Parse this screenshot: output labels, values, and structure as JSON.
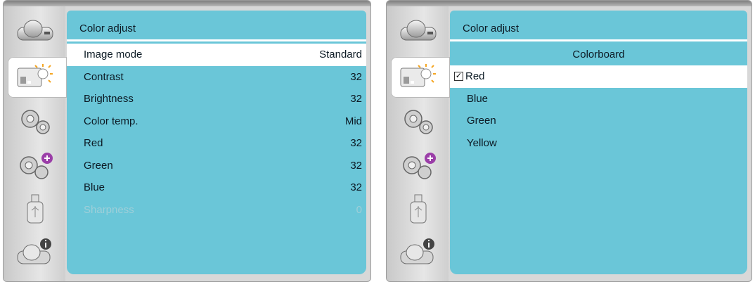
{
  "left": {
    "title": "Color adjust",
    "rows": [
      {
        "label": "Image mode",
        "value": "Standard"
      },
      {
        "label": "Contrast",
        "value": "32"
      },
      {
        "label": "Brightness",
        "value": "32"
      },
      {
        "label": "Color temp.",
        "value": "Mid"
      },
      {
        "label": "Red",
        "value": "32"
      },
      {
        "label": "Green",
        "value": "32"
      },
      {
        "label": "Blue",
        "value": "32"
      },
      {
        "label": "Sharpness",
        "value": "0"
      }
    ]
  },
  "right": {
    "title": "Color adjust",
    "subheader": "Colorboard",
    "options": [
      {
        "label": "Red",
        "checked": true
      },
      {
        "label": "Blue"
      },
      {
        "label": "Green"
      },
      {
        "label": "Yellow"
      }
    ]
  },
  "sidebar_icons": [
    "projector-icon",
    "image-adjust-icon",
    "settings-gear-icon",
    "advanced-settings-gear-icon",
    "usb-icon",
    "information-icon"
  ]
}
